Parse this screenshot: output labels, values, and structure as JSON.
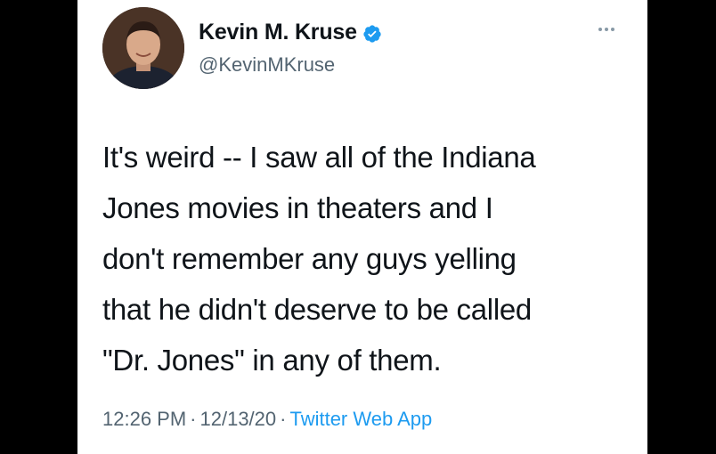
{
  "tweet": {
    "author": {
      "name": "Kevin M. Kruse",
      "handle": "@KevinMKruse",
      "verified": true
    },
    "text_lines": [
      "It's weird -- I saw all of the Indiana",
      "Jones movies in theaters and I",
      "don't remember any guys yelling",
      "that he didn't deserve to be called",
      "\"Dr. Jones\" in any of them."
    ],
    "time": "12:26 PM",
    "date": "12/13/20",
    "separator": "·",
    "source": "Twitter Web App"
  },
  "colors": {
    "background": "#000000",
    "card": "#ffffff",
    "text": "#0f1419",
    "secondary": "#536471",
    "link": "#1d9bf0",
    "verified_badge": "#1d9bf0"
  },
  "icons": {
    "verified": "verified-badge-icon",
    "more": "more-options-icon"
  }
}
